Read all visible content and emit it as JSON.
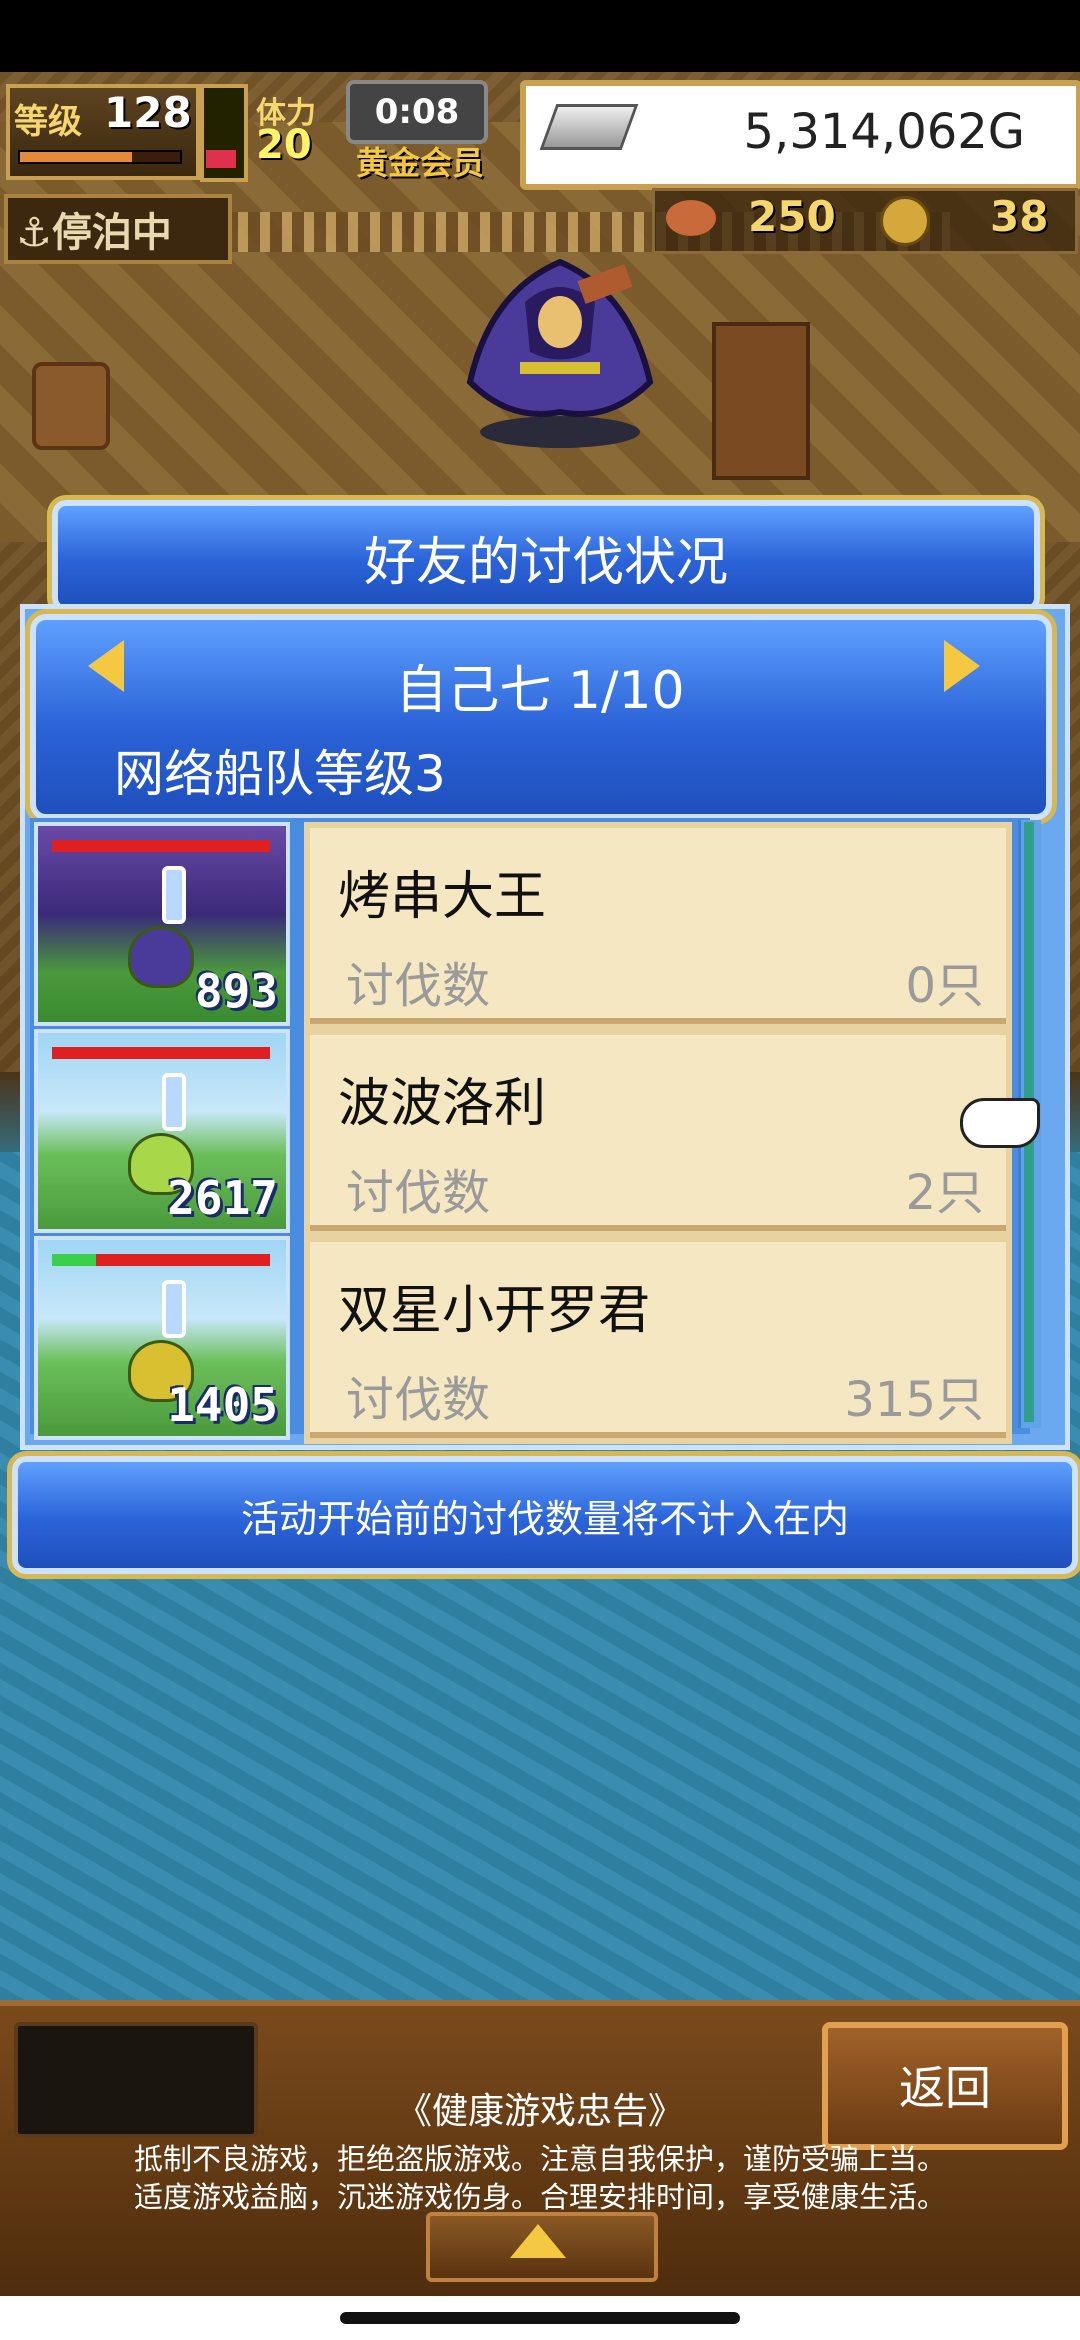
{
  "hud": {
    "level_label": "等级",
    "level_value": "128",
    "exp_fraction": 0.72,
    "stamina_label": "体力",
    "stamina_value": "20",
    "timer": "0:08",
    "membership": "黄金会员",
    "gold": "5,314,062G",
    "dock_status": "停泊中",
    "food": "250",
    "coins": "38"
  },
  "dialog": {
    "title": "好友的讨伐状况",
    "friend_name": "自己七 1/10",
    "fleet_level": "网络船队等级3",
    "notice": "活动开始前的讨伐数量将不计入在内",
    "rows": [
      {
        "name": "烤串大王",
        "label": "讨伐数",
        "count": "0只",
        "thumb_number": "893",
        "hp_fraction": 1.0,
        "hp_green_fraction": 0
      },
      {
        "name": "波波洛利",
        "label": "讨伐数",
        "count": "2只",
        "thumb_number": "2617",
        "hp_fraction": 1.0,
        "hp_green_fraction": 0
      },
      {
        "name": "双星小开罗君",
        "label": "讨伐数",
        "count": "315只",
        "thumb_number": "1405",
        "hp_fraction": 1.0,
        "hp_green_fraction": 0.2
      }
    ]
  },
  "bottom": {
    "back_label": "返回",
    "advisory_title": "《健康游戏忠告》",
    "advisory_line1": "抵制不良游戏，拒绝盗版游戏。注意自我保护，谨防受骗上当。",
    "advisory_line2": "适度游戏益脑，沉迷游戏伤身。合理安排时间，享受健康生活。"
  }
}
